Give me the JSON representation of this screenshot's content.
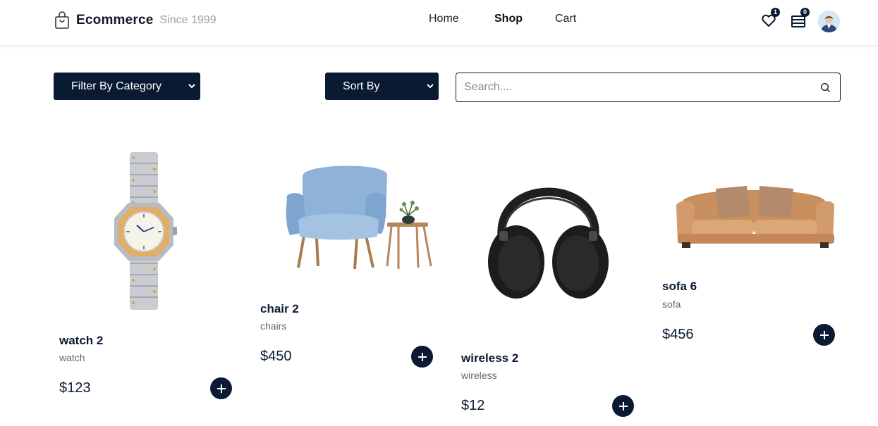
{
  "header": {
    "brand_name": "Ecommerce",
    "brand_since": "Since 1999",
    "nav": {
      "home": "Home",
      "shop": "Shop",
      "cart": "Cart"
    },
    "wishlist_count": "1",
    "cart_count": "0"
  },
  "filters": {
    "category_label": "Filter By Category",
    "sort_label": "Sort By",
    "search_placeholder": "Search...."
  },
  "products": [
    {
      "name": "watch 2",
      "category": "watch",
      "price": "$123"
    },
    {
      "name": "chair 2",
      "category": "chairs",
      "price": "$450"
    },
    {
      "name": "wireless 2",
      "category": "wireless",
      "price": "$12"
    },
    {
      "name": "sofa 6",
      "category": "sofa",
      "price": "$456"
    }
  ],
  "colors": {
    "primary": "#0b1a33",
    "muted": "#9aa0a6"
  }
}
